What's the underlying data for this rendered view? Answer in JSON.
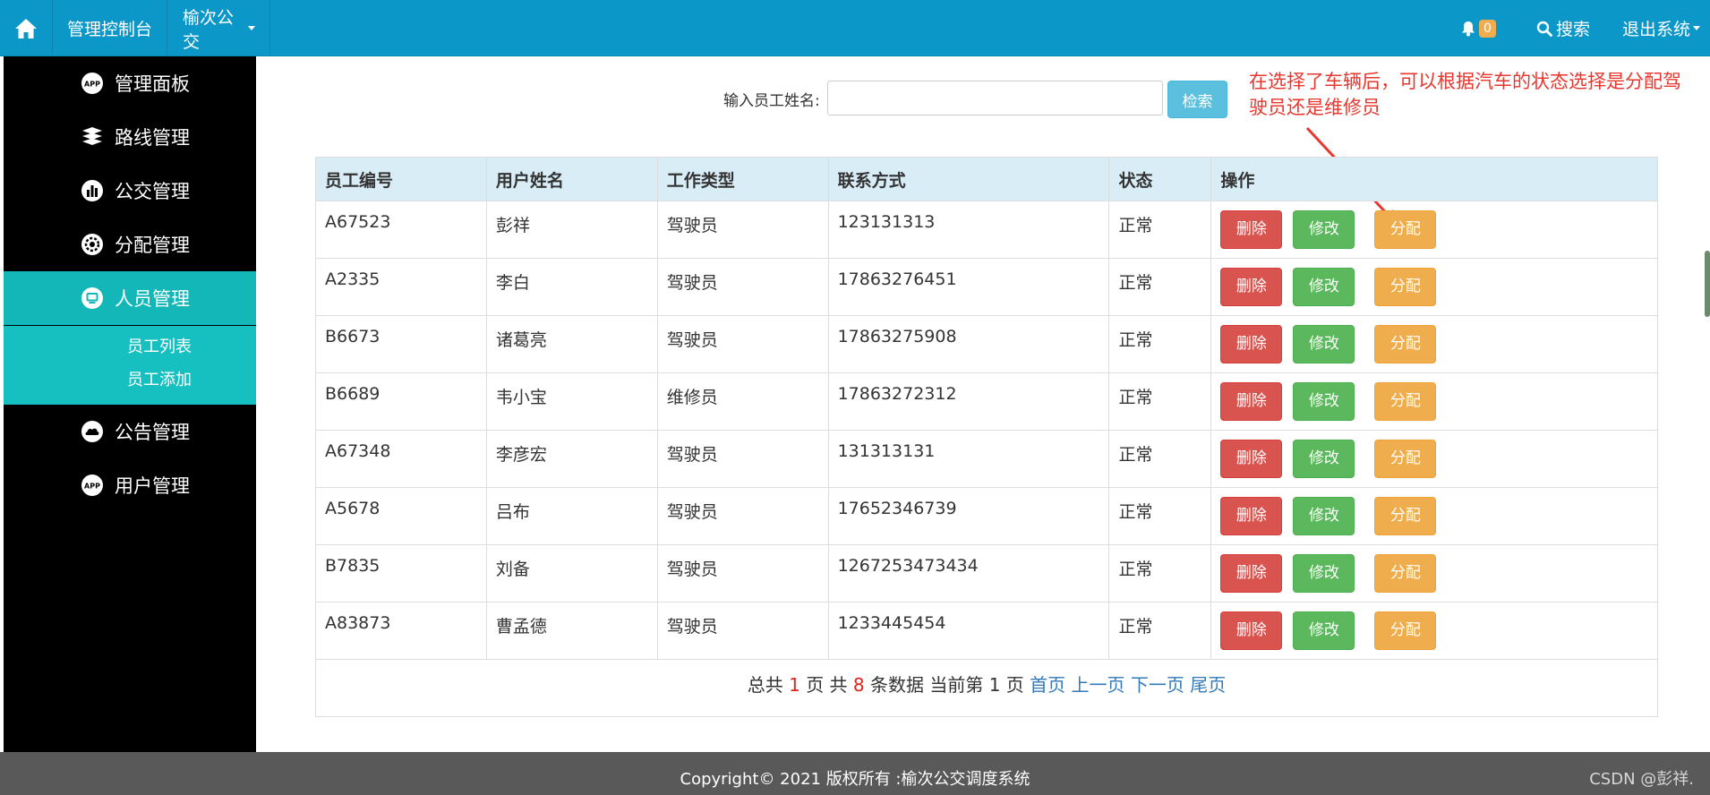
{
  "nav": {
    "home_icon": "home-icon",
    "control_panel": "管理控制台",
    "route_menu": "榆次公交",
    "bell_icon": "bell-icon",
    "notify_count": "0",
    "search_icon": "search-icon",
    "search": "搜索",
    "logout": "退出系统"
  },
  "sidebar": {
    "items": [
      {
        "label": "管理面板",
        "icon": "app-icon"
      },
      {
        "label": "路线管理",
        "icon": "layers-icon"
      },
      {
        "label": "公交管理",
        "icon": "bar-chart-icon"
      },
      {
        "label": "分配管理",
        "icon": "gear-icon"
      },
      {
        "label": "人员管理",
        "icon": "monitor-icon"
      },
      {
        "label": "公告管理",
        "icon": "cloud-icon"
      },
      {
        "label": "用户管理",
        "icon": "app-icon"
      }
    ],
    "submenu": [
      "员工列表",
      "员工添加"
    ]
  },
  "search": {
    "label": "输入员工姓名:",
    "value": "",
    "button": "检索"
  },
  "annotation": "在选择了车辆后，可以根据汽车的状态选择是分配驾驶员还是维修员",
  "table": {
    "headers": [
      "员工编号",
      "用户姓名",
      "工作类型",
      "联系方式",
      "状态",
      "操作"
    ],
    "rows": [
      {
        "id": "A67523",
        "name": "彭祥",
        "type": "驾驶员",
        "phone": "123131313",
        "status": "正常"
      },
      {
        "id": "A2335",
        "name": "李白",
        "type": "驾驶员",
        "phone": "17863276451",
        "status": "正常"
      },
      {
        "id": "B6673",
        "name": "诸葛亮",
        "type": "驾驶员",
        "phone": "17863275908",
        "status": "正常"
      },
      {
        "id": "B6689",
        "name": "韦小宝",
        "type": "维修员",
        "phone": "17863272312",
        "status": "正常"
      },
      {
        "id": "A67348",
        "name": "李彦宏",
        "type": "驾驶员",
        "phone": "131313131",
        "status": "正常"
      },
      {
        "id": "A5678",
        "name": "吕布",
        "type": "驾驶员",
        "phone": "17652346739",
        "status": "正常"
      },
      {
        "id": "B7835",
        "name": "刘备",
        "type": "驾驶员",
        "phone": "1267253473434",
        "status": "正常"
      },
      {
        "id": "A83873",
        "name": "曹孟德",
        "type": "驾驶员",
        "phone": "1233445454",
        "status": "正常"
      }
    ],
    "actions": {
      "delete": "删除",
      "edit": "修改",
      "assign": "分配"
    }
  },
  "pager": {
    "prefix": "总共",
    "pages": "1",
    "pages_unit": "页 共",
    "records": "8",
    "records_unit": "条数据 当前第 1 页",
    "first": "首页",
    "prev": "上一页",
    "next": "下一页",
    "last": "尾页"
  },
  "footer": {
    "copyright": "Copyright© 2021 版权所有 :榆次公交调度系统",
    "watermark": "CSDN @彭祥."
  },
  "colors": {
    "navbar": "#0b97c8",
    "sidebar_active": "#14b7b7",
    "danger": "#d9534f",
    "success": "#5cb85c",
    "warning": "#f0ad4e",
    "info": "#5bc0de",
    "annotation": "#e8372f"
  }
}
